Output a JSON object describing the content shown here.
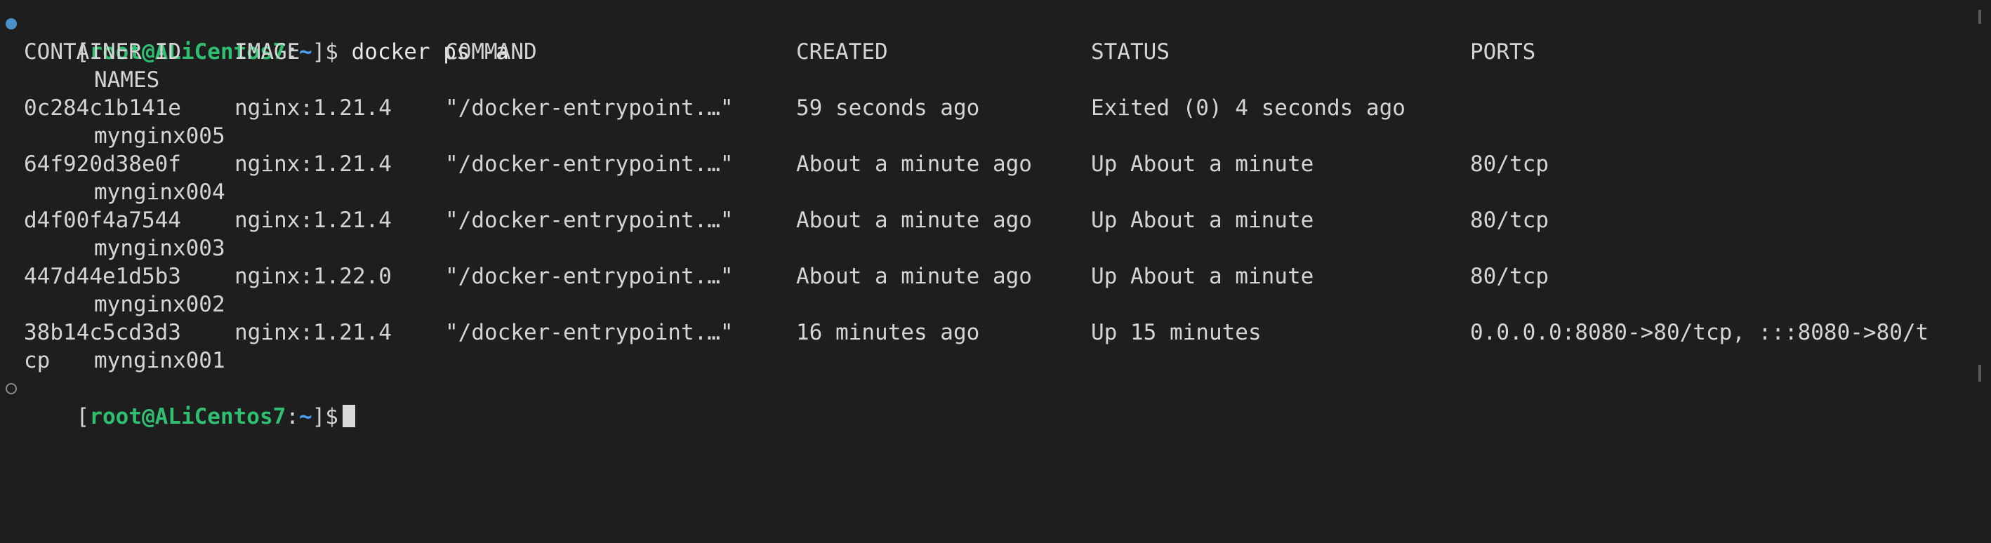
{
  "terminal": {
    "prompt": {
      "open_bracket": "[",
      "user_host": "root@ALiCentos7",
      "separator": ":",
      "path": "~",
      "close": "]$"
    },
    "command": "docker ps -a",
    "headers": {
      "container_id": "CONTAINER ID",
      "image": "IMAGE",
      "command": "COMMAND",
      "created": "CREATED",
      "status": "STATUS",
      "ports": "PORTS",
      "names": "NAMES"
    },
    "rows": [
      {
        "container_id": "0c284c1b141e",
        "image": "nginx:1.21.4",
        "command": "\"/docker-entrypoint.…\"",
        "created": "59 seconds ago",
        "status": "Exited (0) 4 seconds ago",
        "ports": "",
        "ports_wrap": "",
        "name": "mynginx005"
      },
      {
        "container_id": "64f920d38e0f",
        "image": "nginx:1.21.4",
        "command": "\"/docker-entrypoint.…\"",
        "created": "About a minute ago",
        "status": "Up About a minute",
        "ports": "80/tcp",
        "ports_wrap": "",
        "name": "mynginx004"
      },
      {
        "container_id": "d4f00f4a7544",
        "image": "nginx:1.21.4",
        "command": "\"/docker-entrypoint.…\"",
        "created": "About a minute ago",
        "status": "Up About a minute",
        "ports": "80/tcp",
        "ports_wrap": "",
        "name": "mynginx003"
      },
      {
        "container_id": "447d44e1d5b3",
        "image": "nginx:1.22.0",
        "command": "\"/docker-entrypoint.…\"",
        "created": "About a minute ago",
        "status": "Up About a minute",
        "ports": "80/tcp",
        "ports_wrap": "",
        "name": "mynginx002"
      },
      {
        "container_id": "38b14c5cd3d3",
        "image": "nginx:1.21.4",
        "command": "\"/docker-entrypoint.…\"",
        "created": "16 minutes ago",
        "status": "Up 15 minutes",
        "ports": "0.0.0.0:8080->80/tcp, :::8080->80/t",
        "ports_wrap": "cp",
        "name": "mynginx001"
      }
    ],
    "colors": {
      "background": "#1e1e1e",
      "prompt_user": "#2fbf71",
      "prompt_path": "#4aa3ff",
      "gutter_dot": "#4a90c8"
    }
  }
}
